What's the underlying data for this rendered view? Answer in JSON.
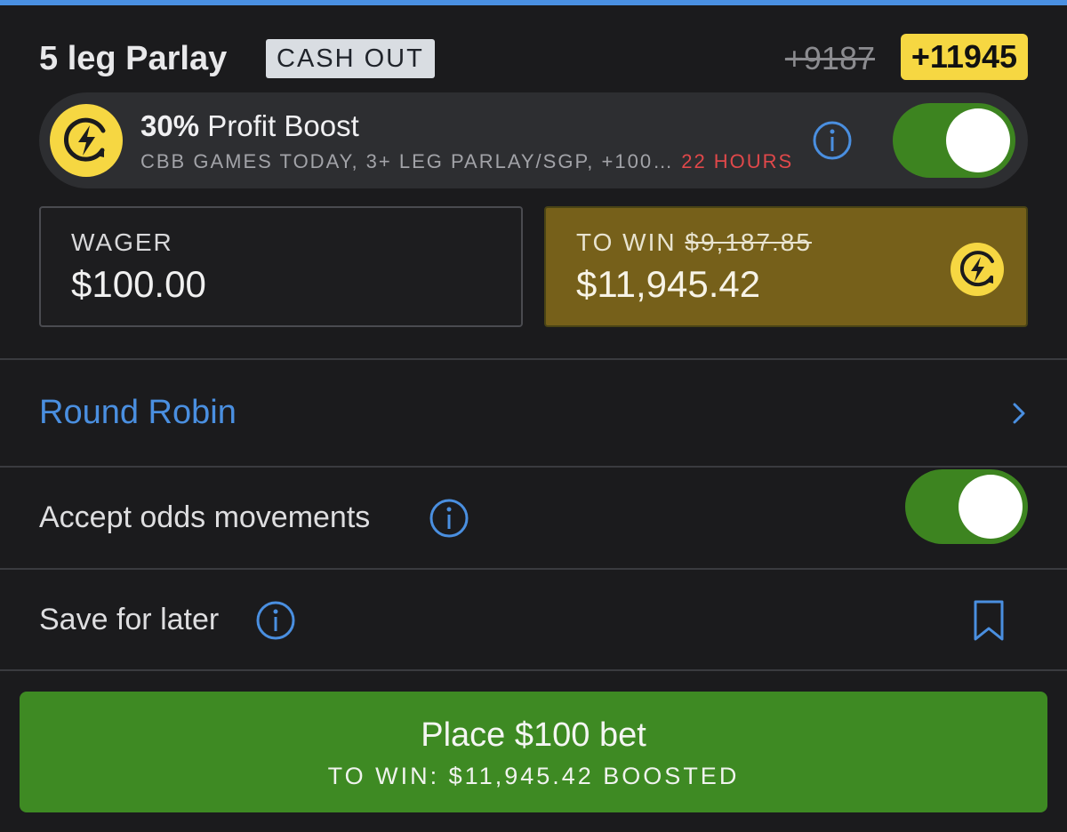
{
  "header": {
    "title": "5 leg Parlay",
    "cashout_badge": "CASH OUT",
    "original_odds": "+9187",
    "boosted_odds": "+11945"
  },
  "boost": {
    "percent": "30%",
    "label": " Profit Boost",
    "description": "CBB GAMES TODAY, 3+ LEG PARLAY/SGP, +100…",
    "time_left": "22 HOURS",
    "enabled": true
  },
  "wager": {
    "label": "WAGER",
    "value": "$100.00"
  },
  "to_win": {
    "label": "TO WIN",
    "original_value": "$9,187.85",
    "value": "$11,945.42"
  },
  "round_robin": {
    "label": "Round Robin"
  },
  "accept_odds": {
    "label": "Accept odds movements",
    "enabled": true
  },
  "save_later": {
    "label": "Save for later"
  },
  "place_bet": {
    "label": "Place $100 bet",
    "sublabel": "TO WIN: $11,945.42 BOOSTED"
  },
  "colors": {
    "background": "#1b1b1d",
    "accent_blue": "#4a8fe0",
    "boost_yellow": "#f6d742",
    "toggle_green": "#3d8420",
    "place_green": "#3e8a23",
    "time_red": "#e0484a"
  },
  "icons": {
    "boost": "lightning-refresh-icon",
    "info": "info-circle-icon",
    "chevron": "chevron-right-icon",
    "bookmark": "bookmark-icon"
  }
}
